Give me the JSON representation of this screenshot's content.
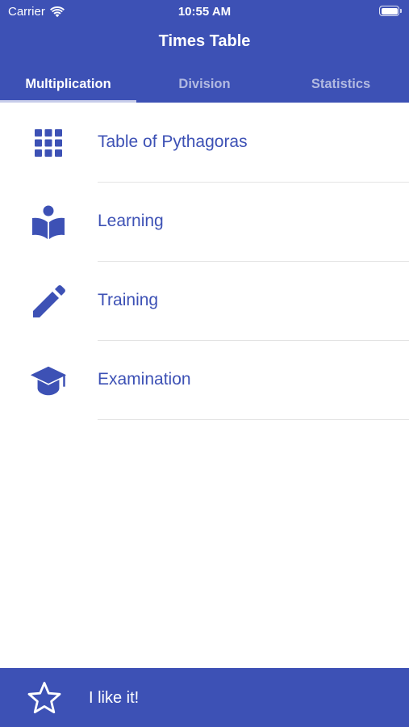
{
  "status_bar": {
    "carrier": "Carrier",
    "time": "10:55 AM"
  },
  "navigation": {
    "title": "Times Table"
  },
  "tabs": [
    {
      "label": "Multiplication",
      "active": true
    },
    {
      "label": "Division",
      "active": false
    },
    {
      "label": "Statistics",
      "active": false
    }
  ],
  "menu": {
    "items": [
      {
        "label": "Table of Pythagoras",
        "icon": "grid-icon"
      },
      {
        "label": "Learning",
        "icon": "reading-book-icon"
      },
      {
        "label": "Training",
        "icon": "pencil-icon"
      },
      {
        "label": "Examination",
        "icon": "graduation-cap-icon"
      }
    ]
  },
  "bottom_bar": {
    "label": "I like it!",
    "icon": "star-outline-icon"
  },
  "colors": {
    "primary": "#3d51b5",
    "background": "#ffffff",
    "divider": "#e3e3e3",
    "tab_indicator": "#c8cdea"
  }
}
